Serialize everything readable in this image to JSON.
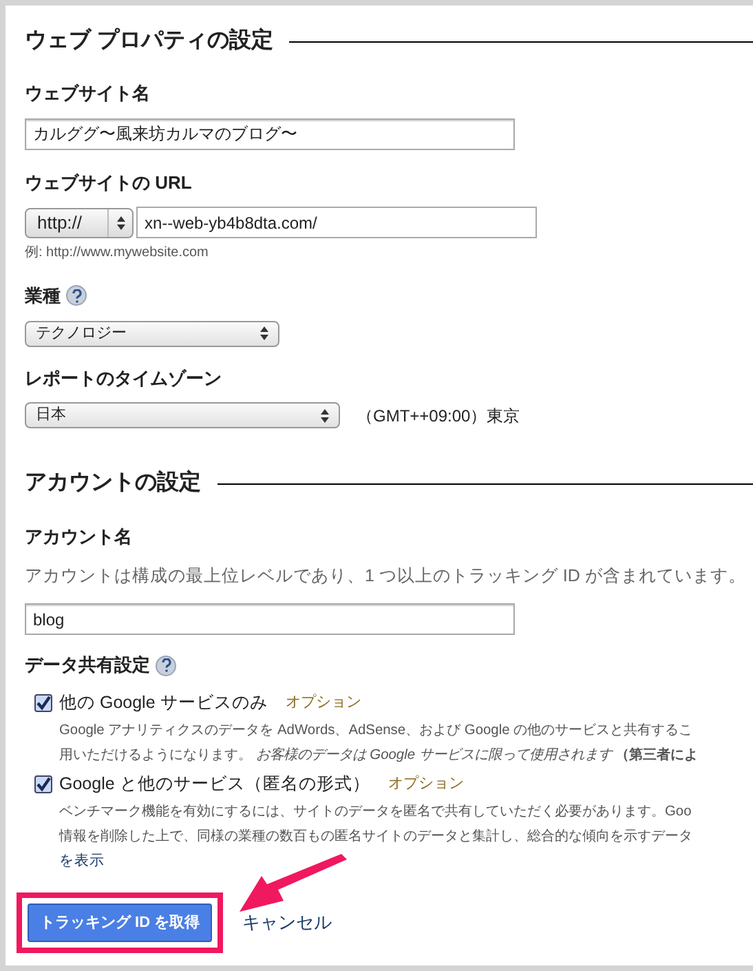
{
  "property_section": {
    "title": "ウェブ プロパティの設定",
    "website_name": {
      "label": "ウェブサイト名",
      "value": "カルググ〜風来坊カルマのブログ〜"
    },
    "website_url": {
      "label": "ウェブサイトの URL",
      "protocol": "http://",
      "value": "xn--web-yb4b8dta.com/",
      "example": "例: http://www.mywebsite.com"
    },
    "industry": {
      "label": "業種",
      "value": "テクノロジー"
    },
    "timezone": {
      "label": "レポートのタイムゾーン",
      "value": "日本",
      "zone": "（GMT++09:00）東京"
    }
  },
  "account_section": {
    "title": "アカウントの設定",
    "account_name": {
      "label": "アカウント名",
      "help": "アカウントは構成の最上位レベルであり、1 つ以上のトラッキング ID が含まれています。",
      "value": "blog"
    },
    "data_sharing": {
      "label": "データ共有設定",
      "options": [
        {
          "label": "他の Google サービスのみ",
          "tag": "オプション",
          "checked": true,
          "lines": [
            "Google アナリティクスのデータを AdWords、AdSense、および Google の他のサービスと共有するこ",
            "用いただけるようになります。 *お客様のデータは Google サービスに限って使用されます* **（第三者によ**"
          ]
        },
        {
          "label": "Google と他のサービス（匿名の形式）",
          "tag": "オプション",
          "checked": true,
          "lines": [
            "ベンチマーク機能を有効にするには、サイトのデータを匿名で共有していただく必要があります。Goo",
            "情報を削除した上で、同様の業種の数百もの匿名サイトのデータと集計し、総合的な傾向を示すデータ"
          ],
          "link": "を表示"
        }
      ]
    }
  },
  "buttons": {
    "primary": "トラッキング ID を取得",
    "cancel": "キャンセル"
  }
}
